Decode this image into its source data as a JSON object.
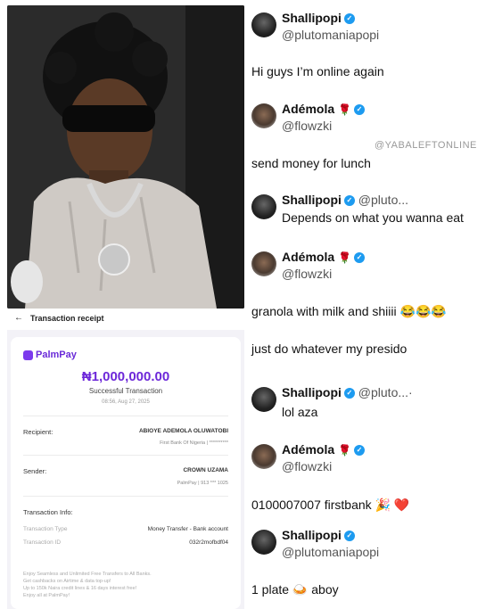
{
  "receipt": {
    "header_title": "Transaction receipt",
    "brand": "PalmPay",
    "amount": "₦1,000,000.00",
    "status": "Successful Transaction",
    "datetime": "08:56, Aug 27, 2025",
    "recipient_label": "Recipient:",
    "recipient_name": "ABIOYE ADEMOLA OLUWATOBI",
    "recipient_bank": "First Bank Of Nigeria | **********",
    "sender_label": "Sender:",
    "sender_name": "CROWN UZAMA",
    "sender_account": "PalmPay | 913 *** 1025",
    "info_label": "Transaction Info:",
    "type_label": "Transaction Type",
    "type_value": "Money Transfer - Bank account",
    "id_label": "Transaction ID",
    "id_value": "032r2mofbdf04",
    "promo_1": "Enjoy Seamless and Unlimited Free Transfers to All Banks.",
    "promo_2": "Get cashbacks on Airtime & data top-up!",
    "promo_3": "Up to 150k Naira credit lines & 16 days interest free!",
    "promo_4": "Enjoy all at PalmPay!"
  },
  "watermark": "@YABALEFTONLINE",
  "tweets": {
    "t1": {
      "name": "Shallipopi",
      "handle": "@plutomaniapopi",
      "text": "Hi guys I’m online again"
    },
    "t2": {
      "name": "Adémola",
      "rose": "🌹",
      "handle": "@flowzki",
      "text": "send money for lunch"
    },
    "t3": {
      "name": "Shallipopi",
      "handle": "@pluto...",
      "text": "Depends on what you wanna eat"
    },
    "t4": {
      "name": "Adémola",
      "rose": "🌹",
      "handle": "@flowzki",
      "text": "granola with milk and shiiii 😂😂😂"
    },
    "t5": {
      "text": "just do whatever my presido"
    },
    "t6": {
      "name": "Shallipopi",
      "handle": "@pluto...",
      "dot": "·",
      "text": "lol aza"
    },
    "t7": {
      "name": "Adémola",
      "rose": "🌹",
      "handle": "@flowzki",
      "text": "0100007007 firstbank 🎉 ❤️"
    },
    "t8": {
      "name": "Shallipopi",
      "handle": "@plutomaniapopi",
      "text": "1 plate 🍛 aboy"
    }
  },
  "icons": {
    "verified": "verified-badge-icon",
    "back": "back-arrow-icon",
    "brand": "palmpay-logo-icon"
  },
  "colors": {
    "palmpay_purple": "#6d28d9",
    "verified_blue": "#1d9bf0"
  }
}
